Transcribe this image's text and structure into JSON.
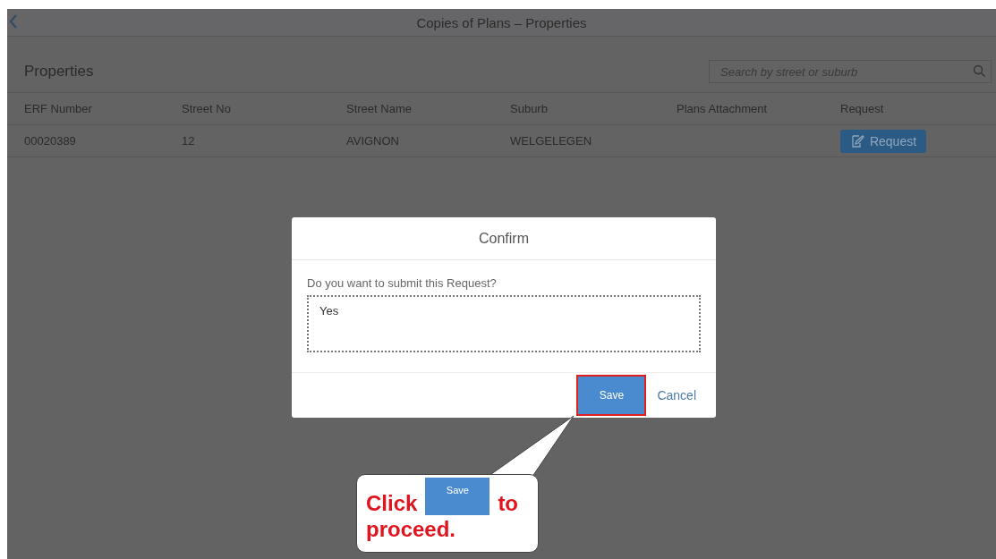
{
  "header": {
    "title": "Copies of Plans – Properties"
  },
  "table": {
    "title": "Properties",
    "search": {
      "placeholder": "Search by street or suburb"
    },
    "columns": [
      "ERF Number",
      "Street No",
      "Street Name",
      "Suburb",
      "Plans Attachment",
      "Request"
    ],
    "rows": [
      {
        "erf": "00020389",
        "street_no": "12",
        "street_name": "AVIGNON",
        "suburb": "WELGELEGEN",
        "request_button": "Request"
      }
    ]
  },
  "dialog": {
    "title": "Confirm",
    "prompt": "Do you want to submit this Request?",
    "answer": "Yes",
    "buttons": [
      {
        "label": "Save",
        "highlighted": true
      },
      {
        "label": "Cancel",
        "highlighted": false
      }
    ]
  },
  "callout": {
    "text_before": "Click",
    "button": "Save",
    "text_after": "to",
    "text_line2": "proceed."
  }
}
